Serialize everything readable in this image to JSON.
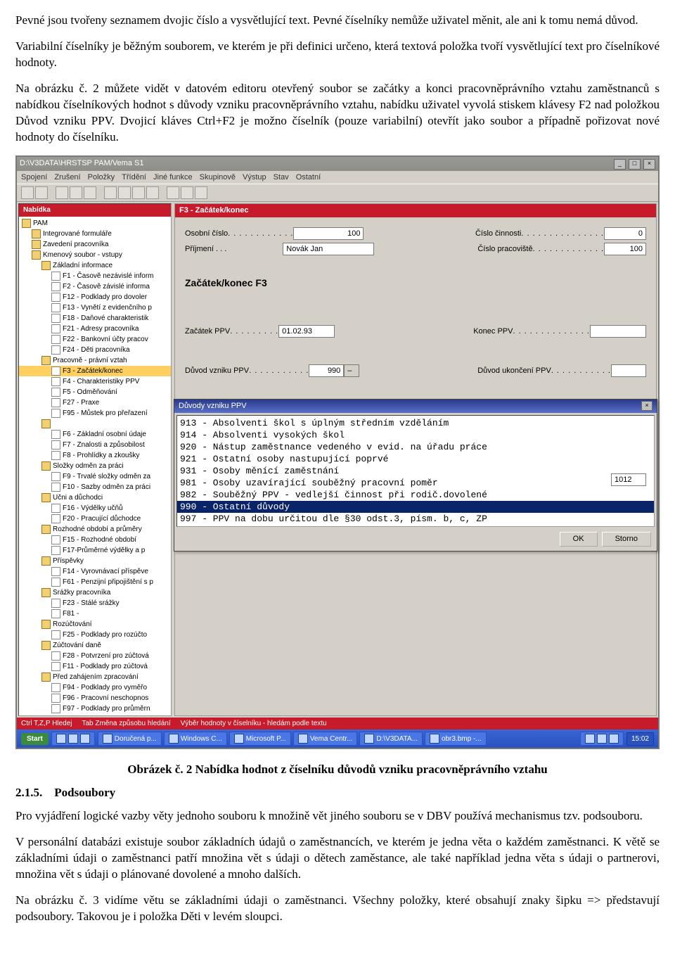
{
  "paras": {
    "p1": "Pevné jsou tvořeny seznamem dvojic číslo a vysvětlující text. Pevné číselníky nemůže uživatel měnit, ale ani k tomu nemá důvod.",
    "p2": "Variabilní číselníky je běžným souborem, ve kterém je při definici určeno, která textová položka tvoří vysvětlující text pro číselníkové hodnoty.",
    "p3": "Na obrázku č. 2 můžete vidět v datovém editoru otevřený soubor se začátky a konci pracovněprávního vztahu zaměstnanců s nabídkou číselníkových hodnot s důvody vzniku pracovněprávního vztahu, nabídku uživatel vyvolá stiskem klávesy F2 nad položkou Důvod vzniku PPV. Dvojicí kláves Ctrl+F2 je možno číselník (pouze variabilní) otevřít jako soubor a případně pořizovat nové hodnoty do číselníku.",
    "caption": "Obrázek č. 2 Nabídka hodnot z číselníku důvodů vzniku pracovněprávního vztahu",
    "h3": "2.1.5. Podsoubory",
    "p4": "Pro vyjádření logické vazby věty jednoho souboru k množině vět jiného souboru se v DBV používá mechanismus tzv. podsouboru.",
    "p5": "V personální databázi existuje soubor základních údajů o zaměstnancích, ve kterém je jedna věta o každém zaměstnanci. K větě se základními údaji o zaměstnanci patří množina vět s údaji o dětech zaměstance, ale také například jedna věta s údaji o partnerovi,  množina vět s údaji o plánované dovolené a mnoho dalších.",
    "p6": "Na obrázku č. 3 vidíme větu se základními údaji o zaměstnanci. Všechny položky, které obsahují znaky šipku => představují podsoubory.  Takovou je i položka Děti v levém sloupci."
  },
  "app": {
    "title": "D:\\V3DATA\\HRSTSP PAM/Vema S1",
    "menus": [
      "Spojení",
      "Zrušení",
      "Položky",
      "Třídění",
      "Jiné funkce",
      "Skupinově",
      "Výstup",
      "Stav",
      "Ostatní"
    ],
    "side_header": "Nabídka",
    "main_header": "F3 - Začátek/konec",
    "tree": [
      {
        "lvl": 0,
        "ico": "b",
        "txt": "PAM"
      },
      {
        "lvl": 1,
        "ico": "b",
        "txt": "Integrované formuláře"
      },
      {
        "lvl": 1,
        "ico": "b",
        "txt": "Zavedení pracovníka"
      },
      {
        "lvl": 1,
        "ico": "b",
        "txt": "Kmenový soubor - vstupy"
      },
      {
        "lvl": 2,
        "ico": "b",
        "txt": "Základní informace"
      },
      {
        "lvl": 3,
        "ico": "y",
        "txt": "F1 - Časově nezávislé inform"
      },
      {
        "lvl": 3,
        "ico": "y",
        "txt": "F2 - Časově závislé informa"
      },
      {
        "lvl": 3,
        "ico": "y",
        "txt": "F12 - Podklady pro dovoler"
      },
      {
        "lvl": 3,
        "ico": "y",
        "txt": "F13 - Vynětí z evidenčního p"
      },
      {
        "lvl": 3,
        "ico": "y",
        "txt": "F18 - Daňové charakteristik"
      },
      {
        "lvl": 3,
        "ico": "y",
        "txt": "F21 - Adresy pracovníka"
      },
      {
        "lvl": 3,
        "ico": "y",
        "txt": "F22 - Bankovní účty pracov"
      },
      {
        "lvl": 3,
        "ico": "y",
        "txt": "F24 - Děti pracovníka"
      },
      {
        "lvl": 2,
        "ico": "b",
        "txt": "Pracovně - právní vztah"
      },
      {
        "lvl": 3,
        "ico": "y",
        "txt": "F3 - Začátek/konec",
        "sel": true
      },
      {
        "lvl": 3,
        "ico": "y",
        "txt": "F4 - Charakteristiky PPV"
      },
      {
        "lvl": 3,
        "ico": "y",
        "txt": "F5 - Odměňování"
      },
      {
        "lvl": 3,
        "ico": "y",
        "txt": "F27 - Praxe"
      },
      {
        "lvl": 3,
        "ico": "y",
        "txt": "F95 - Můstek pro přeřazení"
      },
      {
        "lvl": 2,
        "ico": "b",
        "txt": ""
      },
      {
        "lvl": 3,
        "ico": "y",
        "txt": "F6 - Základní osobní údaje"
      },
      {
        "lvl": 3,
        "ico": "y",
        "txt": "F7 - Znalosti a způsobilost"
      },
      {
        "lvl": 3,
        "ico": "y",
        "txt": "F8 - Prohlídky a zkoušky"
      },
      {
        "lvl": 2,
        "ico": "b",
        "txt": "Složky odměn za práci"
      },
      {
        "lvl": 3,
        "ico": "y",
        "txt": "F9 - Trvalé složky odměn za"
      },
      {
        "lvl": 3,
        "ico": "y",
        "txt": "F10 - Sazby odměn za práci"
      },
      {
        "lvl": 2,
        "ico": "b",
        "txt": "Učni a důchodci"
      },
      {
        "lvl": 3,
        "ico": "y",
        "txt": "F16 - Výdělky učňů"
      },
      {
        "lvl": 3,
        "ico": "y",
        "txt": "F20 - Pracující důchodce"
      },
      {
        "lvl": 2,
        "ico": "b",
        "txt": "Rozhodné období a průměry"
      },
      {
        "lvl": 3,
        "ico": "y",
        "txt": "F15 - Rozhodné období"
      },
      {
        "lvl": 3,
        "ico": "y",
        "txt": "F17-Průměrné výdělky a p"
      },
      {
        "lvl": 2,
        "ico": "b",
        "txt": "Příspěvky"
      },
      {
        "lvl": 3,
        "ico": "y",
        "txt": "F14 - Vyrovnávací příspěve"
      },
      {
        "lvl": 3,
        "ico": "y",
        "txt": "F61 - Penzijní připojištění s p"
      },
      {
        "lvl": 2,
        "ico": "b",
        "txt": "Srážky pracovníka"
      },
      {
        "lvl": 3,
        "ico": "y",
        "txt": "F23 - Stálé srážky"
      },
      {
        "lvl": 3,
        "ico": "y",
        "txt": "F81 - "
      },
      {
        "lvl": 2,
        "ico": "b",
        "txt": "Rozúčtování"
      },
      {
        "lvl": 3,
        "ico": "y",
        "txt": "F25 - Podklady pro rozúčto"
      },
      {
        "lvl": 2,
        "ico": "b",
        "txt": "Zúčtování daně"
      },
      {
        "lvl": 3,
        "ico": "y",
        "txt": "F28 - Potvrzení pro zúčtová"
      },
      {
        "lvl": 3,
        "ico": "y",
        "txt": "F11 - Podklady pro zúčtová"
      },
      {
        "lvl": 2,
        "ico": "b",
        "txt": "Před zahájením zpracování"
      },
      {
        "lvl": 3,
        "ico": "y",
        "txt": "F94 - Podklady pro vyměřo"
      },
      {
        "lvl": 3,
        "ico": "y",
        "txt": "F96 - Pracovní neschopnos"
      },
      {
        "lvl": 3,
        "ico": "y",
        "txt": "F97 - Podklady pro průměrn"
      }
    ],
    "form": {
      "osobni_lbl": "Osobní číslo",
      "osobni_val": "100",
      "cinnost_lbl": "Číslo činnosti",
      "cinnost_val": "0",
      "prijmeni_lbl": "Příjmení . . .",
      "prijmeni_val": "Novák Jan",
      "pracoviste_lbl": "Číslo pracoviště",
      "pracoviste_val": "100",
      "section": "Začátek/konec F3",
      "zacatek_lbl": "Začátek PPV",
      "zacatek_val": "01.02.93",
      "konec_lbl": "Konec PPV",
      "konec_val": "",
      "duvodv_lbl": "Důvod vzniku PPV",
      "duvodv_val": "990",
      "duvodu_lbl": "Důvod ukončení PPV",
      "duvodu_val": "",
      "ext_val": "1012"
    },
    "popup": {
      "title": "Důvody vzniku PPV",
      "items": [
        "913 - Absolventi škol s úplným středním vzděláním",
        "914 - Absolventi vysokých škol",
        "920 - Nástup zaměstnance vedeného v evid. na úřadu práce",
        "921 - Ostatní osoby nastupující poprvé",
        "931 - Osoby měnící zaměstnání",
        "981 - Osoby uzavírající souběžný pracovní poměr",
        "982 - Souběžný PPV - vedlejší činnost při rodič.dovolené",
        "990 - Ostatní důvody",
        "997 - PPV na dobu určitou dle §30 odst.3, písm. b, c, ZP"
      ],
      "selected": 7,
      "ok": "OK",
      "storno": "Storno"
    },
    "status": [
      "Ctrl T,Z,P Hledej",
      "Tab Změna způsobu hledání",
      "Výběr hodnoty v číselníku - hledám podle textu"
    ],
    "taskbar": {
      "start": "Start",
      "items": [
        "Doručená p...",
        "Windows C...",
        "Microsoft P...",
        "Vema Centr...",
        "D:\\V3DATA...",
        "obr3.bmp -..."
      ],
      "time": "15:02"
    }
  }
}
